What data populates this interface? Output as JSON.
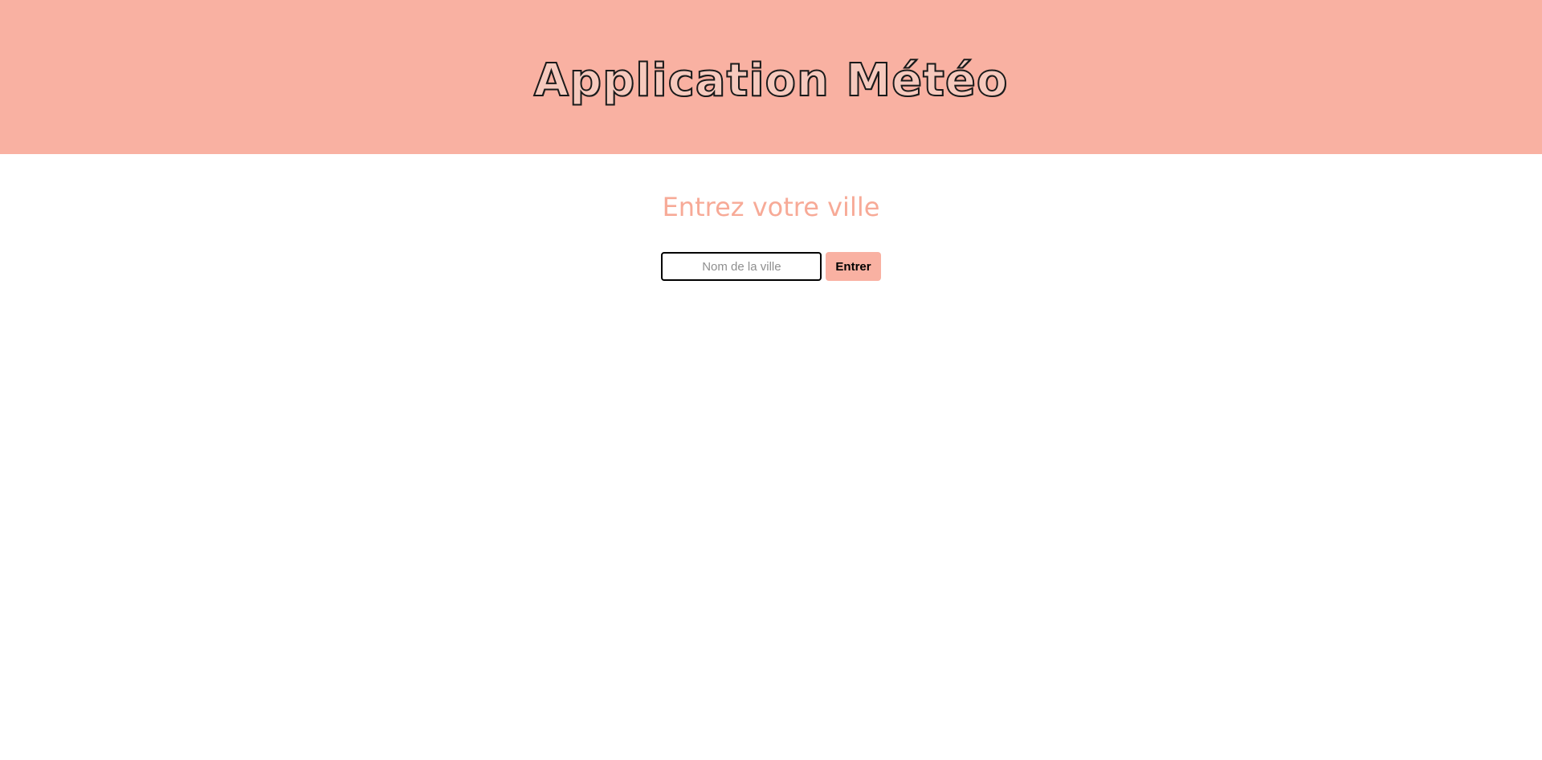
{
  "header": {
    "title": "Application Météo"
  },
  "main": {
    "heading": "Entrez votre ville",
    "city_input": {
      "value": "",
      "placeholder": "Nom de la ville"
    },
    "submit_label": "Entrer"
  },
  "colors": {
    "header_background": "#f9b1a2",
    "heading_text": "#f7aa97",
    "button_background": "#f9b1a2"
  }
}
